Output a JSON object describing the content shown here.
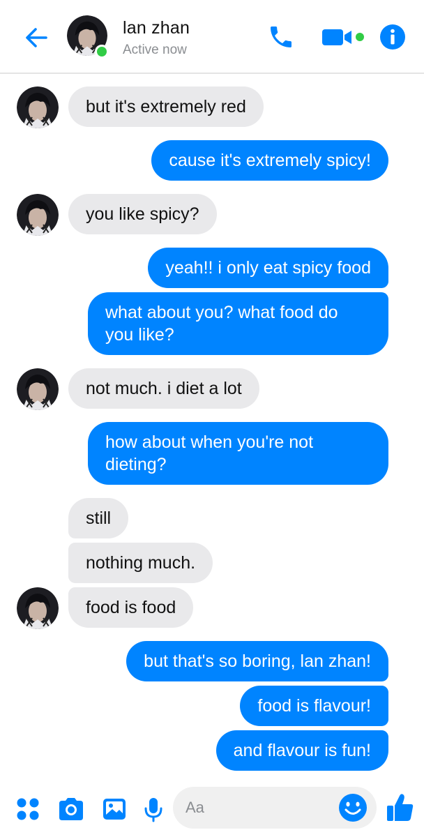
{
  "header": {
    "contact_name": "lan zhan",
    "status": "Active now"
  },
  "colors": {
    "accent": "#0084ff",
    "incoming_bubble": "#e9e9eb",
    "online": "#31cc46"
  },
  "messages": [
    {
      "direction": "incoming",
      "text": "but it's extremely red",
      "avatar": true
    },
    {
      "direction": "outgoing",
      "text": "cause it's extremely spicy!"
    },
    {
      "direction": "incoming",
      "text": "you like spicy?",
      "avatar": true
    },
    {
      "direction": "outgoing",
      "text": "yeah!! i only eat spicy food"
    },
    {
      "direction": "outgoing",
      "lines": [
        "what about you? what food do",
        "you like?"
      ]
    },
    {
      "direction": "incoming",
      "text": "not much. i diet a lot",
      "avatar": true
    },
    {
      "direction": "outgoing",
      "lines": [
        "how about when you're not",
        "dieting?"
      ]
    },
    {
      "direction": "incoming",
      "text": "still",
      "avatar": false
    },
    {
      "direction": "incoming",
      "text": "nothing much.",
      "avatar": false
    },
    {
      "direction": "incoming",
      "text": "food is food",
      "avatar": true
    },
    {
      "direction": "outgoing",
      "text": "but that's so boring, lan zhan!"
    },
    {
      "direction": "outgoing",
      "text": "food is flavour!"
    },
    {
      "direction": "outgoing",
      "text": "and flavour is fun!"
    }
  ],
  "composer": {
    "placeholder": "Aa",
    "icons": [
      "apps-icon",
      "camera-icon",
      "image-icon",
      "microphone-icon",
      "emoji-icon",
      "thumbs-up-icon"
    ]
  }
}
